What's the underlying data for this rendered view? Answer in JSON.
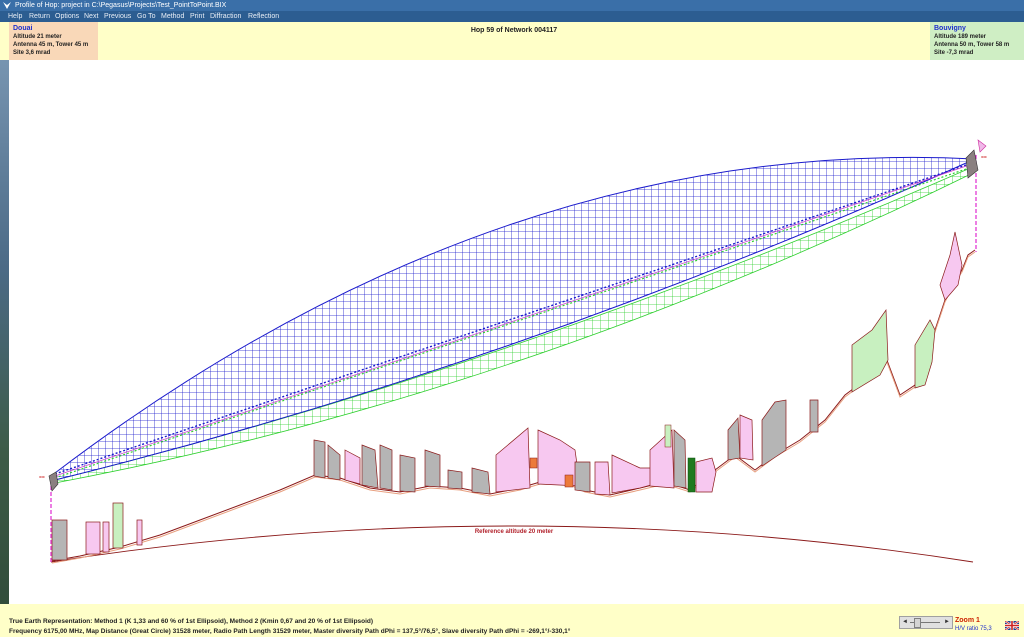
{
  "window": {
    "title": "Profile of Hop: project in C:\\Pegasus\\Projects\\Test_PointToPoint.BIX"
  },
  "menu": [
    "Help",
    "Return",
    "Options",
    "Next",
    "Previous",
    "Go To",
    "Method",
    "Print",
    "Diffraction",
    "Reflection"
  ],
  "header": {
    "center": "Hop 59 of Network 004117",
    "left_site": {
      "name": "Douai",
      "altitude": "Altitude 21 meter",
      "antenna": "Antenna 45 m, Tower 45 m",
      "site_angle": "Site 3,6 mrad"
    },
    "right_site": {
      "name": "Bouvigny",
      "altitude": "Altitude 189 meter",
      "antenna": "Antenna 50 m, Tower 58 m",
      "site_angle": "Site -7,3 mrad"
    }
  },
  "plot": {
    "reference_label": "Reference altitude 20 meter",
    "endpoint_marks": [
      "== ",
      "=="
    ]
  },
  "footer": {
    "line1": "True Earth Representation: Method 1 (K 1,33 and 60 % of 1st Ellipsoid), Method 2 (Kmin 0,67 and 20 % of 1st Ellipsoid)",
    "line2": "Frequency 6175,00 MHz, Map Distance (Great Circle) 31528 meter, Radio Path Length 31529 meter, Master diversity Path dPhi = 137,5°/76,5°, Slave diversity Path dPhi = -269,1°/-330,1°"
  },
  "zoom": {
    "label": "Zoom 1",
    "hv_ratio": "H/V ratio 75,3"
  },
  "colors": {
    "ellipsoid_method1": "#1a1acc",
    "ellipsoid_method2": "#2fd02f",
    "terrain": "#8b1a1a",
    "obstacle_gray": "#b5b5b5",
    "obstacle_pink": "#f7c8f0",
    "obstacle_green": "#c8f0c0",
    "reference_line": "#8b1a1a"
  }
}
